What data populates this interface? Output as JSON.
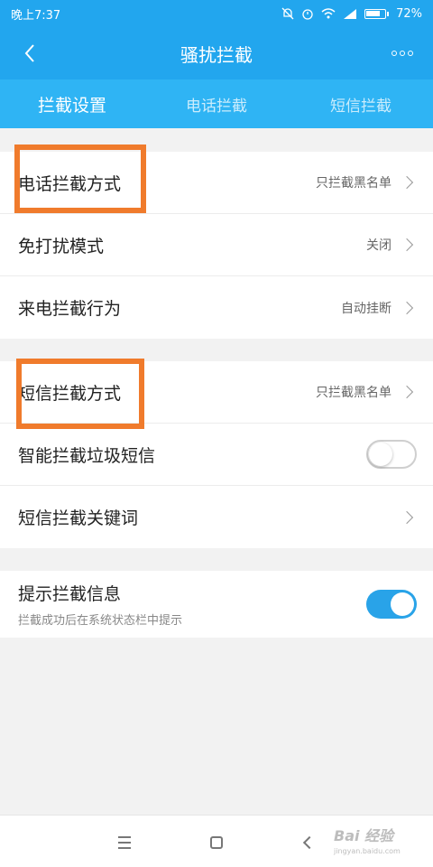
{
  "status_bar": {
    "time": "晚上7:37",
    "battery": "72%"
  },
  "app_bar": {
    "title": "骚扰拦截"
  },
  "tabs": [
    {
      "label": "拦截设置"
    },
    {
      "label": "电话拦截"
    },
    {
      "label": "短信拦截"
    }
  ],
  "call_group": {
    "rows": [
      {
        "label": "电话拦截方式",
        "value": "只拦截黑名单"
      },
      {
        "label": "免打扰模式",
        "value": "关闭"
      },
      {
        "label": "来电拦截行为",
        "value": "自动挂断"
      }
    ]
  },
  "sms_group": {
    "rows": [
      {
        "label": "短信拦截方式",
        "value": "只拦截黑名单"
      },
      {
        "label": "智能拦截垃圾短信",
        "toggle": "off"
      },
      {
        "label": "短信拦截关键词"
      }
    ]
  },
  "notify_group": {
    "label": "提示拦截信息",
    "sub": "拦截成功后在系统状态栏中提示",
    "toggle": "on"
  },
  "watermark": {
    "main": "Bai 经验",
    "sub": "jingyan.baidu.com"
  },
  "colors": {
    "primary": "#22a6ee",
    "tabs_bg": "#2fb4f4",
    "toggle_on": "#29a3e8",
    "highlight": "#f07b2c"
  }
}
